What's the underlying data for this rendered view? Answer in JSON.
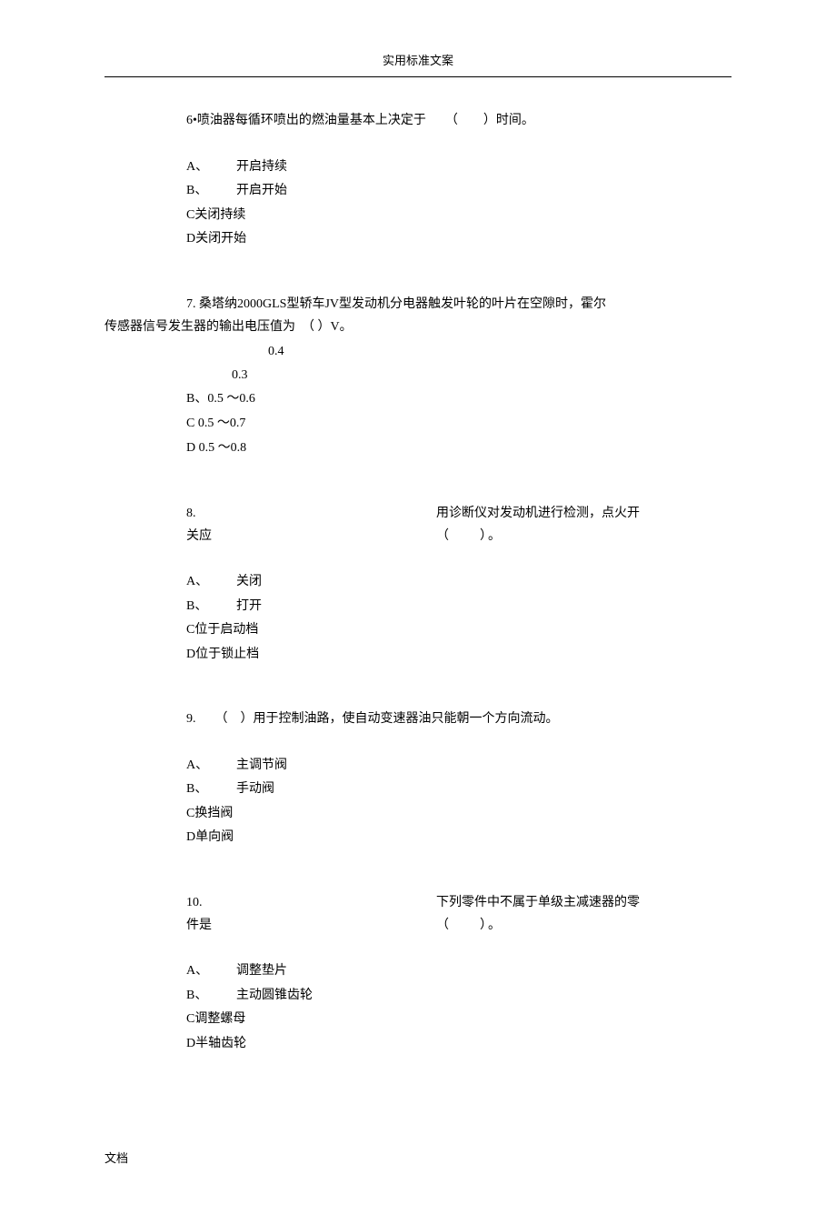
{
  "header": "实用标准文案",
  "footer": "文档",
  "q6": {
    "text": "6•喷油器每循环喷出的燃油量基本上决定于　　（　　）时间。",
    "options": {
      "a_label": "A、",
      "a_text": "开启持续",
      "b_label": "B、",
      "b_text": "开启开始",
      "c": "C关闭持续",
      "d": "D关闭开始"
    }
  },
  "q7": {
    "text1": "7. 桑塔纳2000GLS型轿车JV型发动机分电器触发叶轮的叶片在空隙时，霍尔",
    "text2": "传感器信号发生器的输出电压值为　（ ）V。",
    "extra1": "0.4",
    "extra2": "0.3",
    "options": {
      "b": "B、0.5 ～0.6",
      "c": "C 0.5 ～0.7",
      "d": "D 0.5 ～0.8"
    }
  },
  "q8": {
    "left1": "8.",
    "right1": "用诊断仪对发动机进行检测，点火开",
    "left2": "关应",
    "right2": "（　　）。",
    "options": {
      "a_label": "A、",
      "a_text": "关闭",
      "b_label": "B、",
      "b_text": "打开",
      "c": "C位于启动档",
      "d": "D位于锁止档"
    }
  },
  "q9": {
    "text": "9.　　（　）用于控制油路，使自动变速器油只能朝一个方向流动。",
    "options": {
      "a_label": "A、",
      "a_text": "主调节阀",
      "b_label": "B、",
      "b_text": "手动阀",
      "c": "C换挡阀",
      "d": "D单向阀"
    }
  },
  "q10": {
    "left1": "10.",
    "right1": "下列零件中不属于单级主减速器的零",
    "left2": "件是",
    "right2": "（　　）。",
    "options": {
      "a_label": "A、",
      "a_text": "调整垫片",
      "b_label": "B、",
      "b_text": "主动圆锥齿轮",
      "c": "C调整螺母",
      "d": "D半轴齿轮"
    }
  }
}
